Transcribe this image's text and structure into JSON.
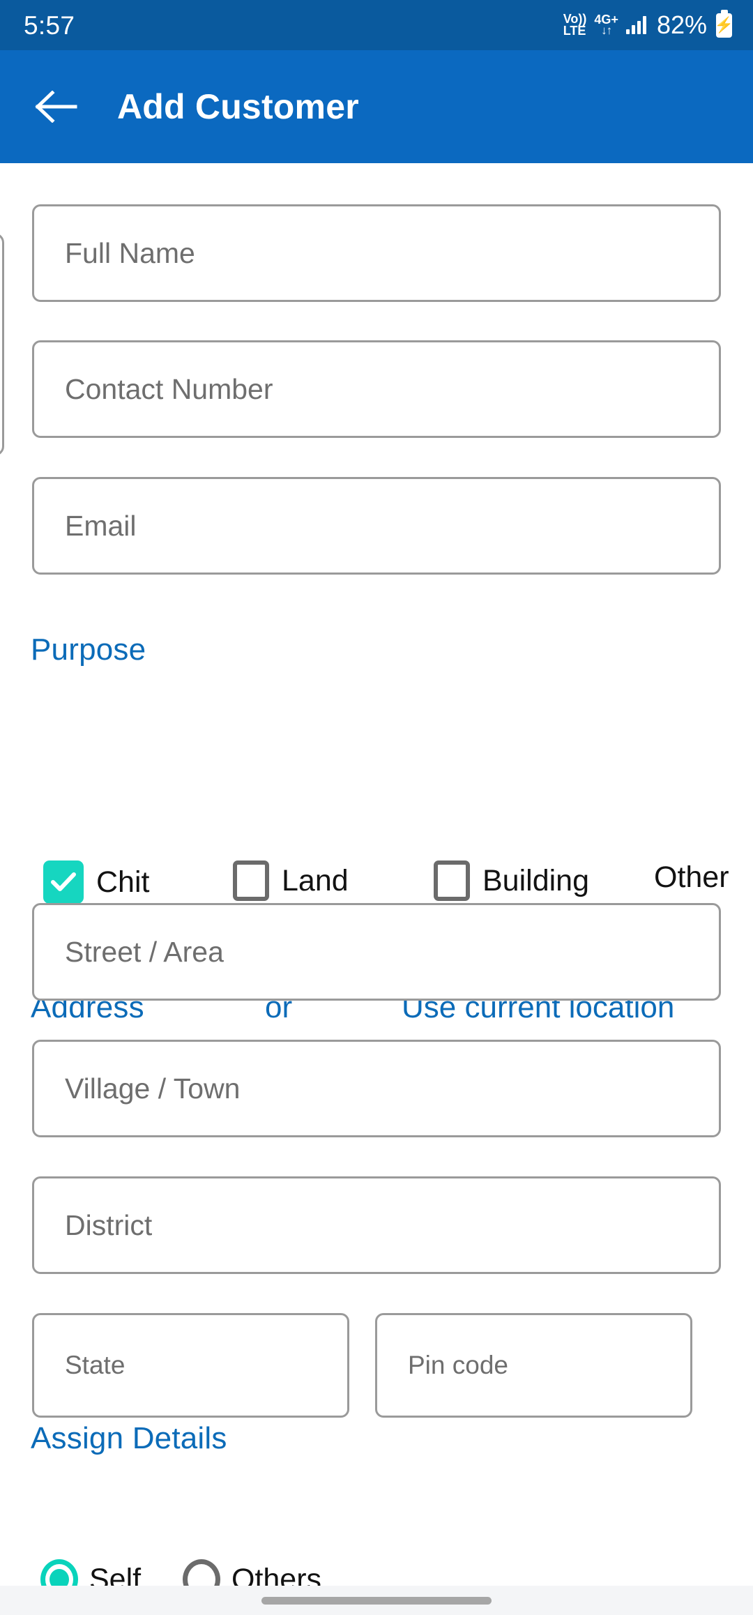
{
  "status_bar": {
    "time": "5:57",
    "volte_top": "Vo))",
    "volte_bottom": "LTE",
    "network_type": "4G+",
    "network_arrows": "↓↑",
    "battery_percent": "82%",
    "battery_bolt": "⚡"
  },
  "app_bar": {
    "back_label": "←",
    "title": "Add Customer"
  },
  "colors": {
    "status_bar_blue": "#0a5a9e",
    "app_bar_blue": "#0b69c0",
    "section_heading_blue": "#0b6bb8",
    "accent_teal": "#16d6c0",
    "radio_teal": "#09d3bb",
    "field_border_gray": "#9a9a9a",
    "placeholder_gray": "#6e6e6e"
  },
  "form": {
    "fields": [
      {
        "name": "full-name",
        "placeholder": "Full Name",
        "value": ""
      },
      {
        "name": "contact-number",
        "placeholder": "Contact Number",
        "value": ""
      },
      {
        "name": "email",
        "placeholder": "Email",
        "value": ""
      }
    ]
  },
  "purpose": {
    "title": "Purpose",
    "options": [
      {
        "label": "Chit",
        "checked": true
      },
      {
        "label": "Land",
        "checked": false
      },
      {
        "label": "Building",
        "checked": false
      },
      {
        "label": "Other",
        "checked": false
      }
    ],
    "check_glyph": "✔"
  },
  "address": {
    "title": "Address",
    "or_label": "or",
    "use_location_label": "Use current location",
    "fields": [
      {
        "name": "street-area",
        "placeholder": "Street / Area",
        "value": ""
      },
      {
        "name": "village-town",
        "placeholder": "Village / Town",
        "value": ""
      },
      {
        "name": "district",
        "placeholder": "District",
        "value": ""
      },
      {
        "name": "state",
        "placeholder": "State",
        "value": ""
      },
      {
        "name": "pin-code",
        "placeholder": "Pin code",
        "value": ""
      }
    ]
  },
  "assign_details": {
    "title": "Assign Details",
    "options": [
      {
        "label": "Self",
        "selected": true
      },
      {
        "label": "Others",
        "selected": false
      }
    ]
  }
}
